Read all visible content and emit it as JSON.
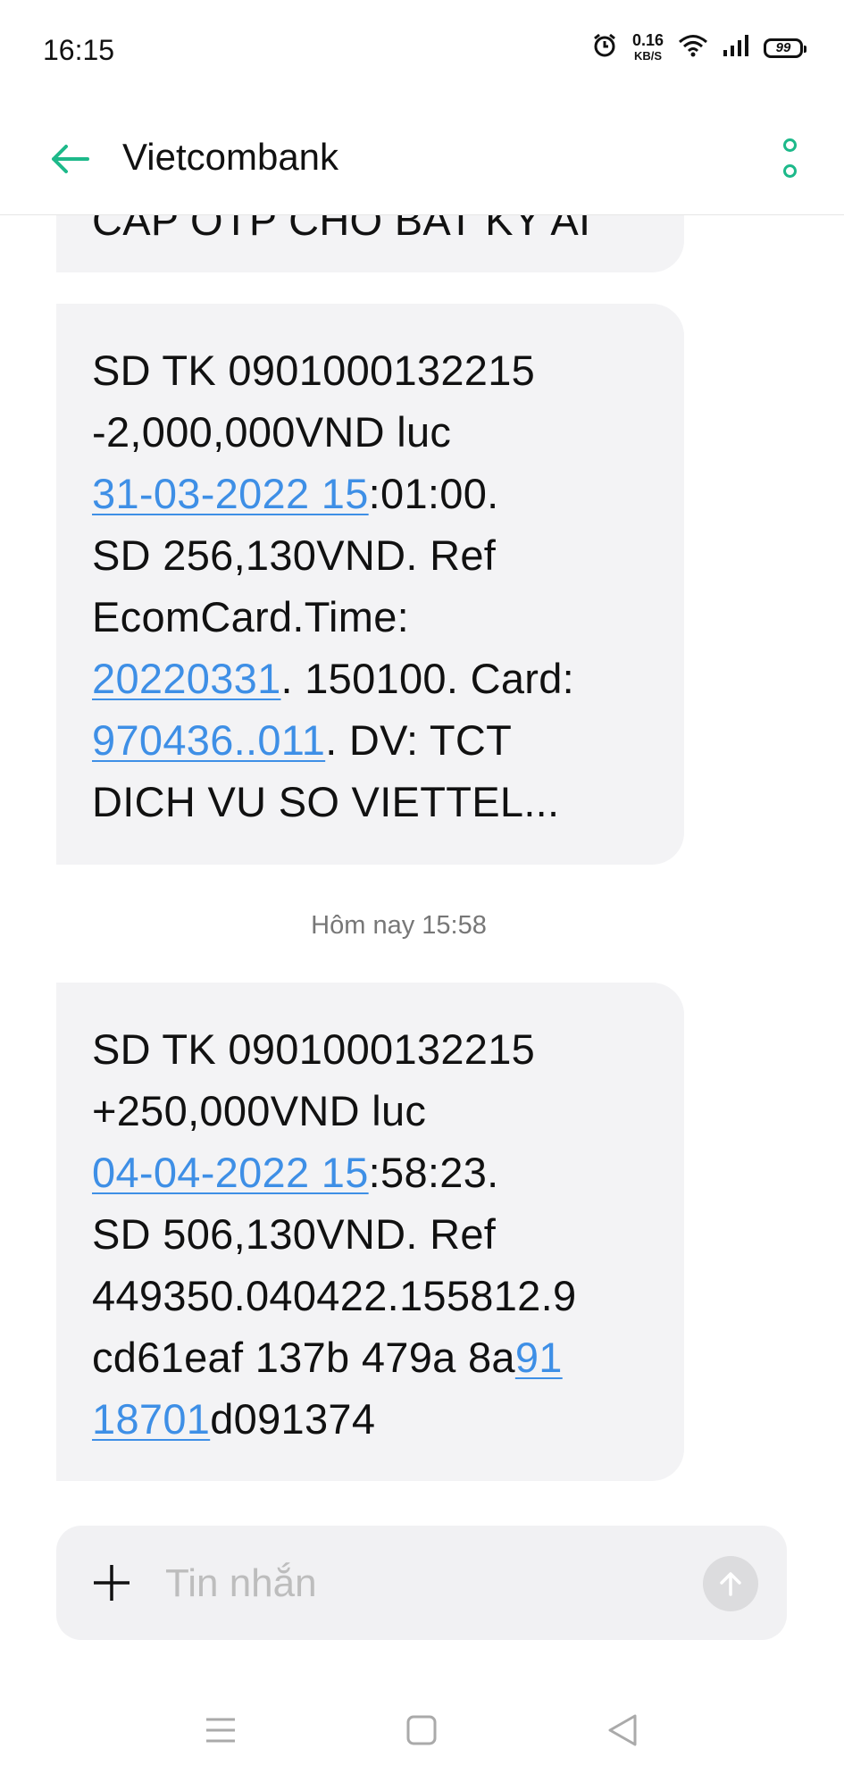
{
  "status_bar": {
    "time": "16:15",
    "net_speed_value": "0.16",
    "net_speed_unit": "KB/S",
    "battery_level": "99",
    "icons": [
      "alarm-icon",
      "wifi-icon",
      "signal-icon",
      "battery-icon"
    ]
  },
  "header": {
    "title": "Vietcombank",
    "back_icon": "arrow-left-icon",
    "menu_icon": "more-vertical-icon",
    "accent_color": "#1db98a"
  },
  "messages": [
    {
      "lines": [
        [
          {
            "text": "CAP OTP CHO BAT KY AI",
            "link": false
          }
        ]
      ]
    },
    {
      "lines": [
        [
          {
            "text": "SD TK 0901000132215",
            "link": false
          }
        ],
        [
          {
            "text": "-2,000,000VND luc",
            "link": false
          }
        ],
        [
          {
            "text": "31-03-2022 15",
            "link": true
          },
          {
            "text": ":01:00.",
            "link": false
          }
        ],
        [
          {
            "text": "SD 256,130VND. Ref",
            "link": false
          }
        ],
        [
          {
            "text": "EcomCard.Time:",
            "link": false
          }
        ],
        [
          {
            "text": "20220331",
            "link": true
          },
          {
            "text": ". 150100. Card:",
            "link": false
          }
        ],
        [
          {
            "text": "970436..011",
            "link": true
          },
          {
            "text": ". DV: TCT",
            "link": false
          }
        ],
        [
          {
            "text": "DICH VU SO VIETTEL...",
            "link": false
          }
        ]
      ]
    },
    {
      "lines": [
        [
          {
            "text": "SD TK 0901000132215",
            "link": false
          }
        ],
        [
          {
            "text": "+250,000VND luc",
            "link": false
          }
        ],
        [
          {
            "text": "04-04-2022 15",
            "link": true
          },
          {
            "text": ":58:23.",
            "link": false
          }
        ],
        [
          {
            "text": "SD 506,130VND. Ref",
            "link": false
          }
        ],
        [
          {
            "text": "449350.040422.155812.9",
            "link": false
          }
        ],
        [
          {
            "text": "cd61eaf 137b 479a 8a",
            "link": false
          },
          {
            "text": "91",
            "link": true
          }
        ],
        [
          {
            "text": "18701",
            "link": true
          },
          {
            "text": "d091374",
            "link": false
          }
        ]
      ]
    }
  ],
  "date_divider": "Hôm nay 15:58",
  "composer": {
    "placeholder": "Tin nhắn",
    "add_icon": "plus-icon",
    "send_icon": "send-arrow-up-icon"
  },
  "nav_bar": {
    "icons": [
      "menu-icon",
      "home-square-icon",
      "back-triangle-icon"
    ]
  },
  "colors": {
    "bubble_bg": "#f3f3f5",
    "link": "#3e8fe6",
    "accent": "#1db98a"
  }
}
